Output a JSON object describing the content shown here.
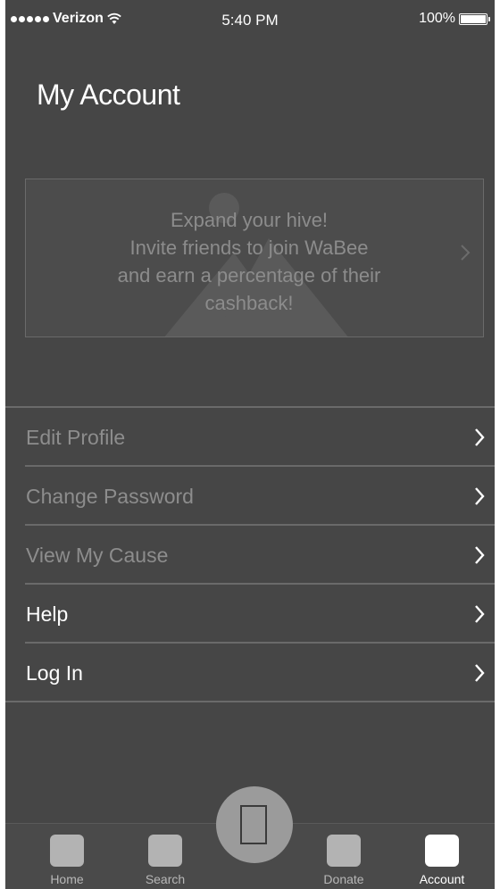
{
  "status_bar": {
    "carrier": "Verizon",
    "time": "5:40 PM",
    "battery": "100%"
  },
  "page_title": "My Account",
  "banner": {
    "lines": [
      "Expand your hive!",
      "Invite friends to join WaBee",
      "and earn a percentage of their",
      "cashback!"
    ]
  },
  "menu": {
    "items": [
      {
        "label": "Edit Profile",
        "enabled": false
      },
      {
        "label": "Change Password",
        "enabled": false
      },
      {
        "label": "View My Cause",
        "enabled": false
      },
      {
        "label": "Help",
        "enabled": true
      },
      {
        "label": "Log In",
        "enabled": true
      }
    ]
  },
  "tabbar": {
    "tabs": [
      {
        "label": "Home",
        "icon": "home-icon",
        "active": false
      },
      {
        "label": "Search",
        "icon": "search-icon",
        "active": false
      },
      {
        "label": "Donate",
        "icon": "donate-icon",
        "active": false
      },
      {
        "label": "Account",
        "icon": "account-icon",
        "active": true
      }
    ],
    "center_icon": "phone-icon"
  },
  "colors": {
    "background": "#464646",
    "divider": "#6a6a6a",
    "disabled_text": "#8d8d8d",
    "active_text": "#ffffff",
    "center_button": "#9b9b9b"
  }
}
